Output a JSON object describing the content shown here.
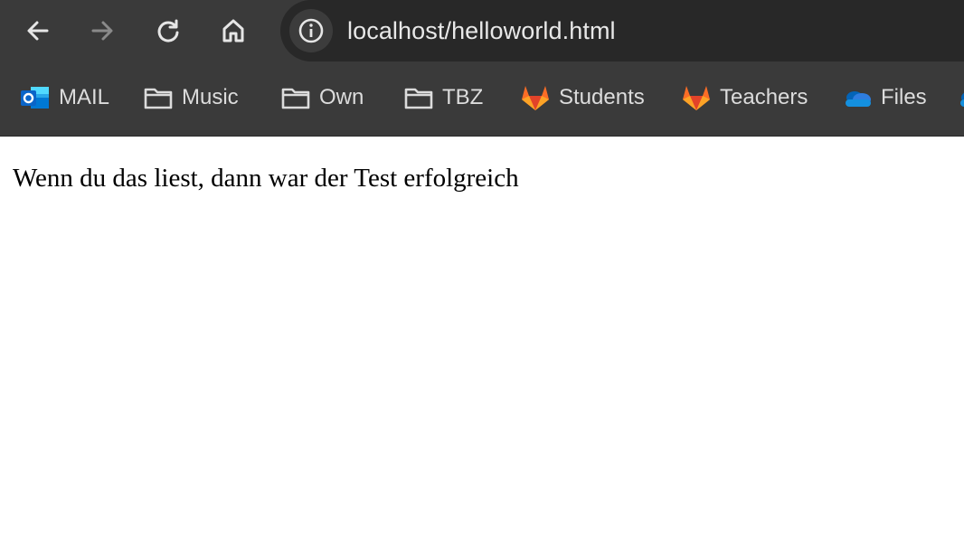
{
  "toolbar": {
    "back_icon": "arrow-left-icon",
    "forward_icon": "arrow-right-icon",
    "reload_icon": "reload-icon",
    "home_icon": "home-icon",
    "site_info_icon": "info-icon",
    "url": "localhost/helloworld.html"
  },
  "bookmarks": {
    "items": [
      {
        "label": "MAIL",
        "icon": "outlook-icon"
      },
      {
        "label": "Music",
        "icon": "folder-icon"
      },
      {
        "label": "Own",
        "icon": "folder-icon"
      },
      {
        "label": "TBZ",
        "icon": "folder-icon"
      },
      {
        "label": "Students",
        "icon": "gitlab-icon"
      },
      {
        "label": "Teachers",
        "icon": "gitlab-icon"
      },
      {
        "label": "Files",
        "icon": "onedrive-icon"
      }
    ]
  },
  "page": {
    "text": "Wenn du das liest, dann war der Test erfolgreich"
  },
  "colors": {
    "toolbar_bg": "#3a3a3a",
    "omnibox_bg": "#282828",
    "gitlab_orange": "#e24329",
    "outlook_blue": "#0a64c8",
    "onedrive_blue": "#2e7de0"
  }
}
